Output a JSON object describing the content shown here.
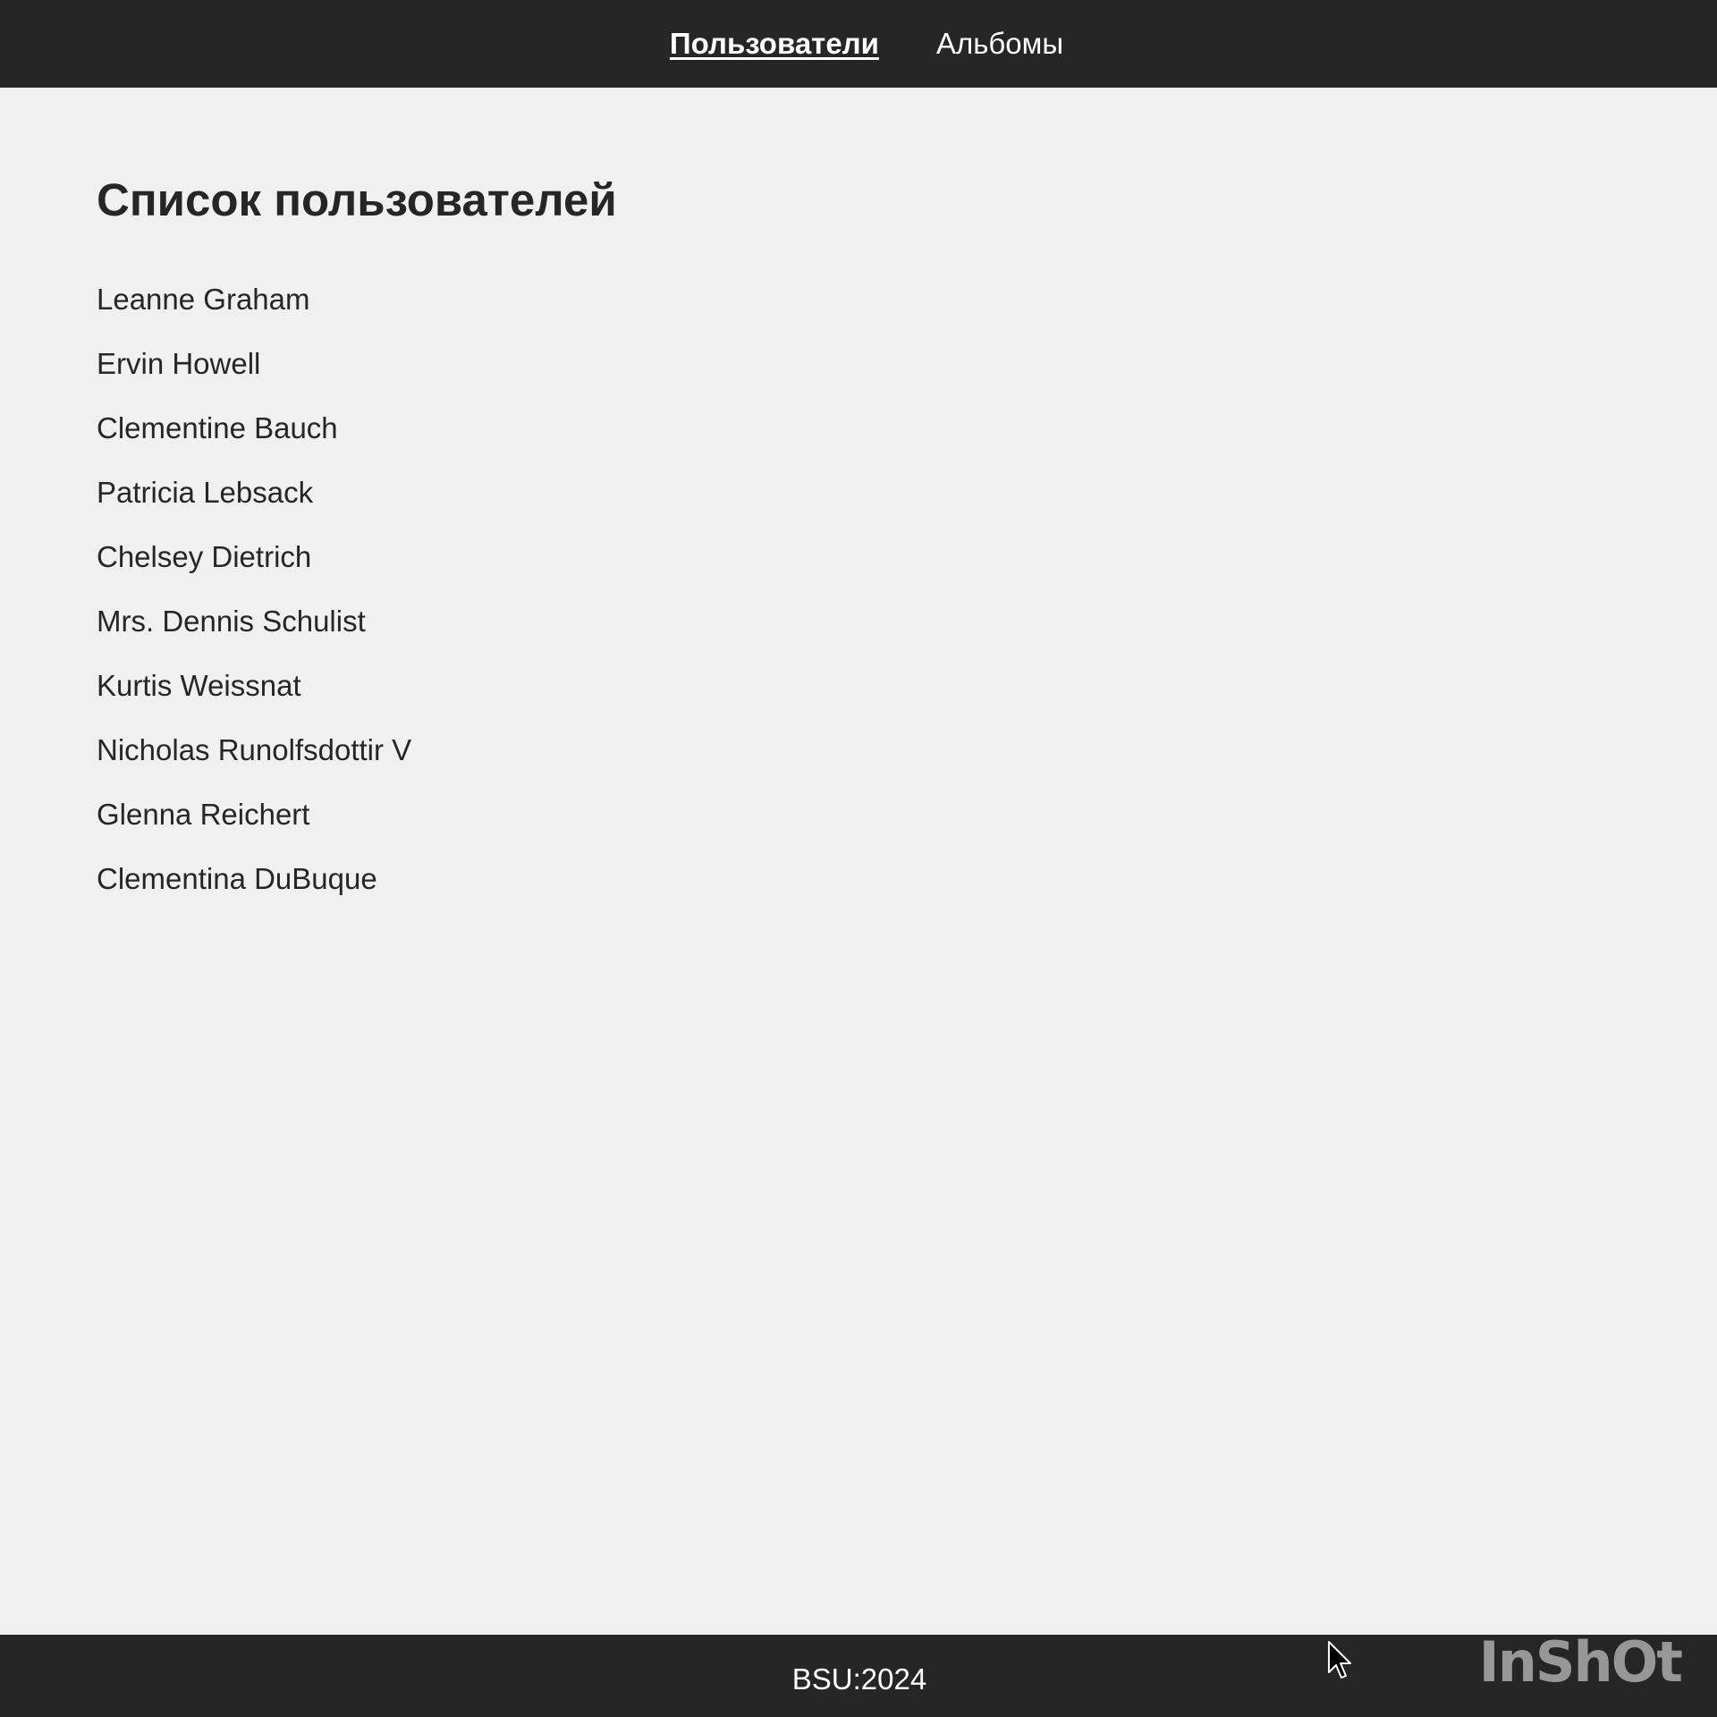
{
  "nav": {
    "items": [
      {
        "label": "Пользователи",
        "active": true
      },
      {
        "label": "Альбомы",
        "active": false
      }
    ]
  },
  "main": {
    "title": "Список пользователей",
    "users": [
      "Leanne Graham",
      "Ervin Howell",
      "Clementine Bauch",
      "Patricia Lebsack",
      "Chelsey Dietrich",
      "Mrs. Dennis Schulist",
      "Kurtis Weissnat",
      "Nicholas Runolfsdottir V",
      "Glenna Reichert",
      "Clementina DuBuque"
    ]
  },
  "footer": {
    "text": "BSU:2024"
  },
  "watermark": {
    "text": "InShOt"
  },
  "colors": {
    "bar_background": "#262626",
    "page_background": "#f0f0f0",
    "text": "#262626"
  },
  "icons": [
    "mouse-pointer-icon"
  ]
}
